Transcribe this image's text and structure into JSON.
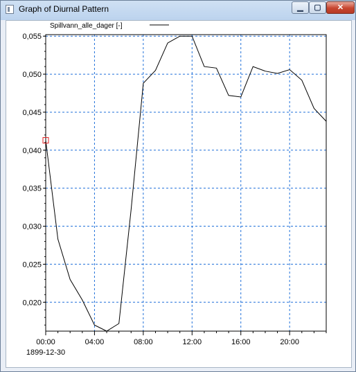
{
  "window": {
    "title": "Graph of Diurnal Pattern",
    "minimize_glyph": "▁",
    "maximize_glyph": "▢",
    "close_glyph": "✕"
  },
  "colors": {
    "grid": "#1e6fd9",
    "series": "#000000",
    "first_point_marker": "#e02020"
  },
  "chart_data": {
    "type": "line",
    "title": "",
    "xlabel": "",
    "ylabel": "",
    "date_label": "1899-12-30",
    "legend": {
      "placement": "top-left",
      "entries": [
        "Spillvann_alle_dager [-]"
      ]
    },
    "grid": true,
    "xlim": [
      0,
      23
    ],
    "ylim": [
      0.0162,
      0.0552
    ],
    "x_ticks": [
      "00:00",
      "04:00",
      "08:00",
      "12:00",
      "16:00",
      "20:00"
    ],
    "x_tick_values": [
      0,
      4,
      8,
      12,
      16,
      20
    ],
    "y_ticks": [
      "0,020",
      "0,025",
      "0,030",
      "0,035",
      "0,040",
      "0,045",
      "0,050",
      "0,055"
    ],
    "y_tick_values": [
      0.02,
      0.025,
      0.03,
      0.035,
      0.04,
      0.045,
      0.05,
      0.055
    ],
    "series": [
      {
        "name": "Spillvann_alle_dager [-]",
        "x": [
          0,
          1,
          2,
          3,
          4,
          5,
          6,
          7,
          8,
          9,
          10,
          11,
          12,
          13,
          14,
          15,
          16,
          17,
          18,
          19,
          20,
          21,
          22,
          23
        ],
        "values": [
          0.0413,
          0.0283,
          0.023,
          0.0203,
          0.017,
          0.0162,
          0.0172,
          0.0322,
          0.0488,
          0.0505,
          0.0541,
          0.055,
          0.055,
          0.051,
          0.0508,
          0.0472,
          0.047,
          0.051,
          0.0504,
          0.0501,
          0.0506,
          0.0492,
          0.0455,
          0.0438
        ]
      }
    ]
  }
}
